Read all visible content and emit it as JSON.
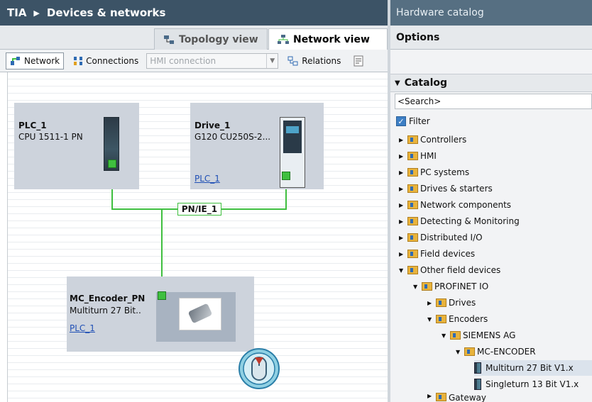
{
  "header": {
    "root": "TIA",
    "title": "Devices & networks"
  },
  "hardware_catalog": {
    "title": "Hardware catalog"
  },
  "tabs": [
    {
      "label": "Topology view"
    },
    {
      "label": "Network view"
    }
  ],
  "options": {
    "label": "Options"
  },
  "toolbar": {
    "network_label": "Network",
    "connections_label": "Connections",
    "connection_type": "HMI connection",
    "relations_label": "Relations"
  },
  "devices": {
    "plc": {
      "name": "PLC_1",
      "type": "CPU 1511-1 PN"
    },
    "drive": {
      "name": "Drive_1",
      "type": "G120 CU250S-2...",
      "link": "PLC_1"
    },
    "encoder": {
      "name": "MC_Encoder_PN",
      "type": "Multiturn 27 Bit..",
      "link": "PLC_1"
    }
  },
  "network": {
    "label": "PN/IE_1",
    "color": "#3fbf3f"
  },
  "catalog": {
    "header": "Catalog",
    "search_placeholder": "<Search>",
    "filter_label": "Filter",
    "items": [
      {
        "label": "Controllers"
      },
      {
        "label": "HMI"
      },
      {
        "label": "PC systems"
      },
      {
        "label": "Drives & starters"
      },
      {
        "label": "Network components"
      },
      {
        "label": "Detecting & Monitoring"
      },
      {
        "label": "Distributed I/O"
      },
      {
        "label": "Field devices"
      },
      {
        "label": "Other field devices"
      },
      {
        "label": "PROFINET IO"
      },
      {
        "label": "Drives"
      },
      {
        "label": "Encoders"
      },
      {
        "label": "SIEMENS AG"
      },
      {
        "label": "MC-ENCODER"
      },
      {
        "label": "Multiturn 27 Bit V1.x"
      },
      {
        "label": "Singleturn 13 Bit V1.x"
      },
      {
        "label": "Gateway"
      }
    ]
  },
  "colors": {
    "title_bar": "#3c5366",
    "accent_blue": "#1f4fb5",
    "network_green": "#3fbf3f"
  }
}
